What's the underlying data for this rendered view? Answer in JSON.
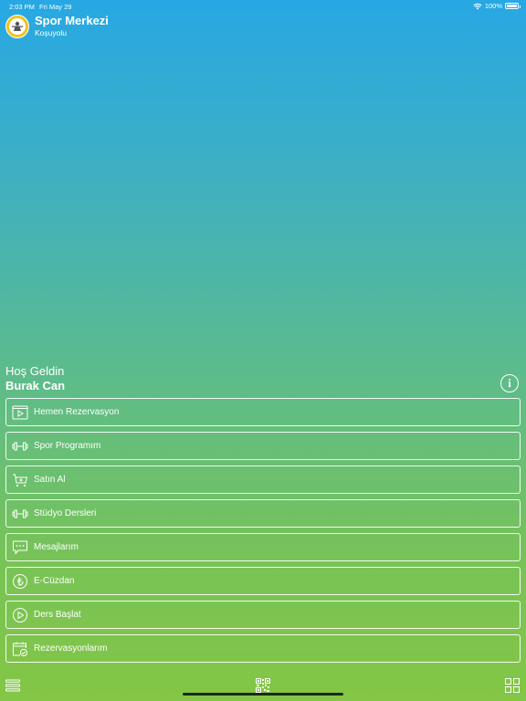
{
  "status_bar": {
    "time": "2:03 PM",
    "date": "Fri May 29",
    "battery": "100%"
  },
  "header": {
    "club_name": "Spor Merkezi",
    "branch": "Koşuyolu"
  },
  "welcome": {
    "greeting": "Hoş Geldin",
    "user_name": "Burak Can"
  },
  "menu": {
    "items": [
      {
        "label": "Hemen Rezervasyon",
        "icon": "play-square-icon"
      },
      {
        "label": "Spor Programım",
        "icon": "dumbbell-icon"
      },
      {
        "label": "Satın Al",
        "icon": "cart-icon"
      },
      {
        "label": "Stüdyo Dersleri",
        "icon": "dumbbell-icon"
      },
      {
        "label": "Mesajlarım",
        "icon": "chat-icon"
      },
      {
        "label": "E-Cüzdan",
        "icon": "lira-coin-icon"
      },
      {
        "label": "Ders Başlat",
        "icon": "play-circle-icon"
      },
      {
        "label": "Rezervasyonlarım",
        "icon": "calendar-check-icon"
      }
    ]
  },
  "bottom_bar": {
    "left_icon": "list-menu-icon",
    "center_icon": "qr-code-icon",
    "right_icon": "grid-icon"
  },
  "colors": {
    "gradient_top": "#27a8e4",
    "gradient_bottom": "#84c645",
    "text": "#ffffff"
  }
}
